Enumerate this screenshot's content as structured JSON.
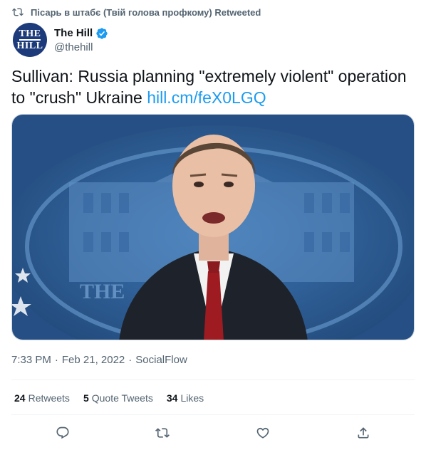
{
  "retweet_context": {
    "text": "Пісарь в штабє (Твій голова профкому) Retweeted",
    "icon": "retweet-icon"
  },
  "author": {
    "display_name": "The Hill",
    "handle": "@thehill",
    "avatar_text_top": "THE",
    "avatar_text_bottom": "HILL",
    "verified": true
  },
  "tweet": {
    "text": "Sullivan: Russia planning \"extremely violent\" operation to \"crush\" Ukraine ",
    "link": "hill.cm/feX0LGQ"
  },
  "media": {
    "background_text": "THE"
  },
  "meta": {
    "time": "7:33 PM",
    "separator": "·",
    "date": "Feb 21, 2022",
    "source": "SocialFlow"
  },
  "stats": [
    {
      "count": "24",
      "label": "Retweets"
    },
    {
      "count": "5",
      "label": "Quote Tweets"
    },
    {
      "count": "34",
      "label": "Likes"
    }
  ],
  "actions": [
    "reply-icon",
    "retweet-icon",
    "like-icon",
    "share-icon"
  ],
  "colors": {
    "link": "#1d9bf0",
    "secondary": "#536471",
    "verified": "#1d9bf0"
  }
}
